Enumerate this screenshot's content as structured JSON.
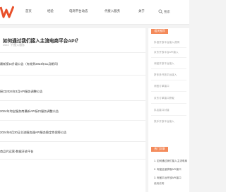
{
  "nav": {
    "items": [
      "首页",
      "经验",
      "电商平台动态",
      "代接入服务",
      "关于"
    ],
    "search_placeholder": "搜索"
  },
  "article": {
    "title": "如何通过我们接入主流电商平台API？",
    "meta": "2024 · 代接入服务"
  },
  "related": [
    "最新接口升级公告（有效到2024年11月期间）",
    "接口2024年3月API服务调整公告",
    "2024年淘宝服务商最新API接口服务调整公告",
    "2024年6月30日主流服务器API服务稳定性保障公告",
    "商品代运营-数据开放平台"
  ],
  "sidebar": {
    "section1_label": "相关推荐",
    "section1_items": [
      "抖音开放平台接入说明",
      "京东开放平台API接入",
      "淘宝开放平台接入",
      "拼多多开放平台接入",
      "淘宝订单接口",
      "京东订单接口获取",
      "抖店接口对接",
      "快手开放平台接入"
    ],
    "section2_label": "热门文章",
    "section2_items": [
      "1. 如何通过我们接入主流电商",
      "2. 淘宝全量获取API接口",
      "3. 淘宝平台开放API接口",
      "使用说明"
    ]
  },
  "colors": {
    "brand": "#e8502a",
    "accent": "#f48a5a"
  }
}
